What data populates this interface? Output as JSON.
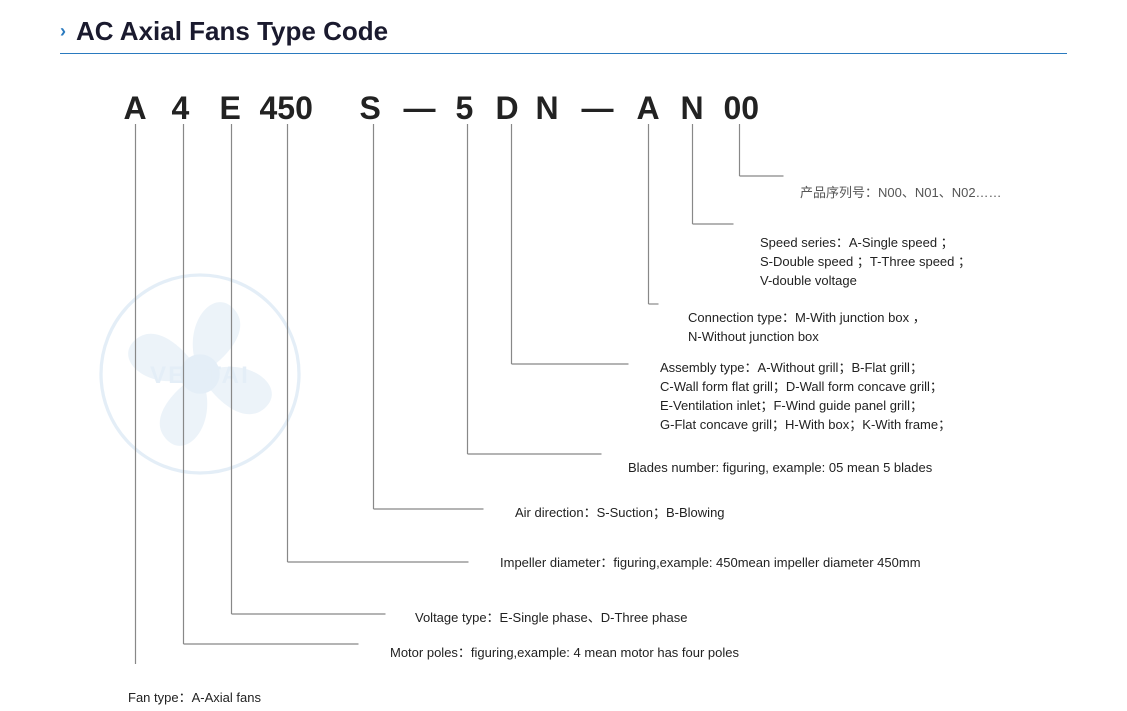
{
  "header": {
    "chevron": "›",
    "title": "AC Axial Fans Type Code",
    "divider": true
  },
  "type_code": {
    "letters": [
      "A",
      "4",
      "E",
      "450",
      "S",
      "—",
      "5",
      "D",
      "N",
      "—",
      "A",
      "N",
      "00"
    ]
  },
  "labels": {
    "product_series": {
      "chinese": "产品序列号：N00、N01、N02……",
      "english": ""
    },
    "speed_series": {
      "line1": "Speed series：A-Single speed ；",
      "line2": "S-Double speed ；T-Three speed ；",
      "line3": "V-double voltage"
    },
    "connection": {
      "line1": "Connection type：M-With junction box ，",
      "line2": "N-Without junction box"
    },
    "assembly": {
      "line1": "Assembly type：A-Without grill；B-Flat grill；",
      "line2": "C-Wall form flat grill；D-Wall form concave grill；",
      "line3": "E-Ventilation inlet；F-Wind guide panel grill；",
      "line4": "G-Flat concave grill；H-With box；K-With frame；"
    },
    "blades": "Blades number: figuring, example: 05 mean 5 blades",
    "air_direction": "Air direction：S-Suction；B-Blowing",
    "impeller": "Impeller diameter：figuring,example: 450mean impeller diameter 450mm",
    "voltage": "Voltage type：E-Single phase、D-Three phase",
    "motor_poles": "Motor poles：figuring,example: 4 mean motor has four poles",
    "fan_type": "Fan type：A-Axial fans"
  }
}
